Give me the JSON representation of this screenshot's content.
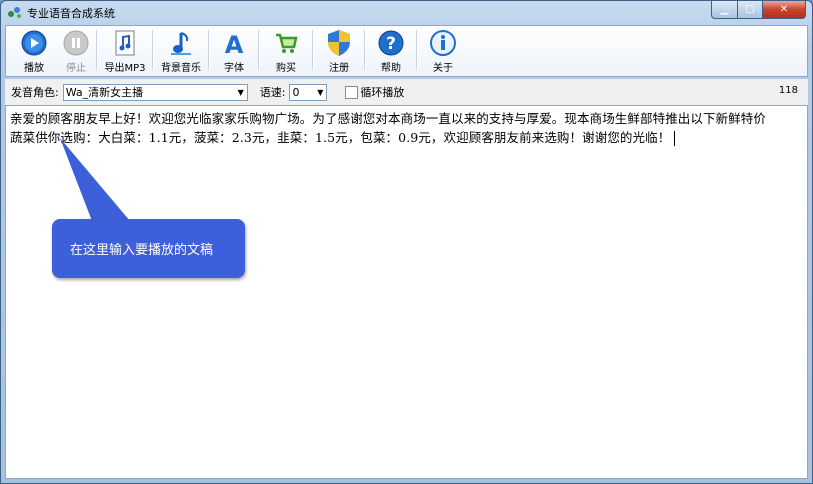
{
  "window": {
    "title": "专业语音合成系统"
  },
  "toolbar": {
    "play": "播放",
    "stop": "停止",
    "export": "导出MP3",
    "bgm": "背景音乐",
    "font": "字体",
    "buy": "购买",
    "register": "注册",
    "help": "帮助",
    "about": "关于"
  },
  "options": {
    "voice_label": "发音角色:",
    "voice_value": "Wa_清新女主播",
    "speed_label": "语速:",
    "speed_value": "0",
    "loop_label": "循环播放",
    "char_count": "118"
  },
  "editor": {
    "line1": "亲爱的顾客朋友早上好！欢迎您光临家家乐购物广场。为了感谢您对本商场一直以来的支持与厚爱。现本商场生鲜部特推出以下新鲜特价",
    "line2": "蔬菜供你选购：大白菜：1.1元，菠菜：2.3元，韭菜：1.5元，包菜：0.9元，欢迎顾客朋友前来选购！谢谢您的光临！"
  },
  "callout": {
    "text": "在这里输入要播放的文稿"
  },
  "colors": {
    "callout": "#3d5fd9",
    "titlebar": "#b1cbe6",
    "close": "#c7432d"
  }
}
